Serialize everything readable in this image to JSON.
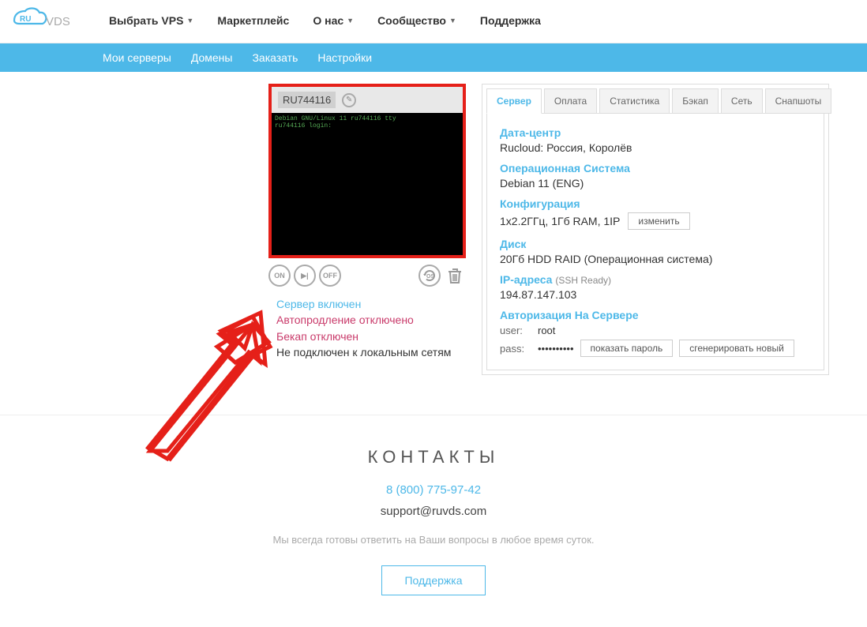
{
  "nav": {
    "primary": [
      "Выбрать VPS",
      "Маркетплейс",
      "О нас",
      "Сообщество",
      "Поддержка"
    ],
    "dropdown_indices": [
      0,
      2,
      3
    ],
    "secondary": [
      "Мои серверы",
      "Домены",
      "Заказать",
      "Настройки"
    ]
  },
  "server": {
    "id": "RU744116",
    "console_text": "Debian GNU/Linux 11 ru744116 tty\nru744116 login:",
    "controls": {
      "on": "ON",
      "next": "▶|",
      "off": "OFF",
      "os": "OS"
    },
    "status": {
      "on": "Сервер включен",
      "autorenew_off": "Автопродление отключено",
      "backup_off": "Бекап отключен",
      "no_lan": "Не подключен к локальным сетям"
    }
  },
  "tabs": [
    "Сервер",
    "Оплата",
    "Статистика",
    "Бэкап",
    "Сеть",
    "Снапшоты"
  ],
  "details": {
    "dc_h": "Дата-центр",
    "dc_v": "Rucloud: Россия, Королёв",
    "os_h": "Операционная Система",
    "os_v": "Debian 11 (ENG)",
    "cfg_h": "Конфигурация",
    "cfg_v": "1x2.2ГГц, 1Гб RAM, 1IP",
    "cfg_btn": "изменить",
    "disk_h": "Диск",
    "disk_v": "20Гб HDD RAID (Операционная система)",
    "ip_h": "IP-адреса",
    "ip_ssh": "(SSH Ready)",
    "ip_v": "194.87.147.103",
    "auth_h": "Авторизация На Сервере",
    "user_k": "user:",
    "user_v": "root",
    "pass_k": "pass:",
    "pass_v": "••••••••••",
    "show_pass": "показать пароль",
    "gen_pass": "сгенерировать новый"
  },
  "footer": {
    "title": "КОНТАКТЫ",
    "phone": "8 (800) 775-97-42",
    "mail": "support@ruvds.com",
    "note": "Мы всегда готовы ответить на Ваши вопросы в любое время суток.",
    "support_btn": "Поддержка"
  }
}
